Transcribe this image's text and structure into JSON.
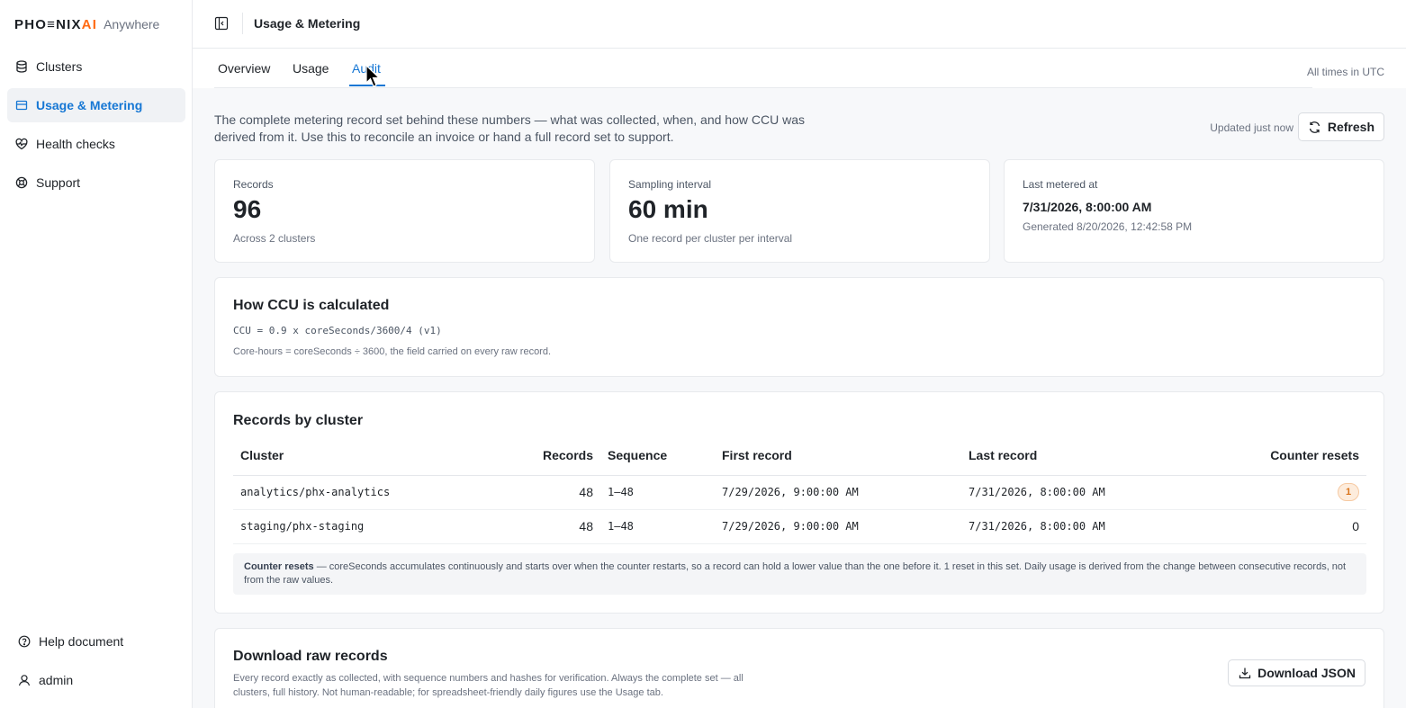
{
  "brand": {
    "logo_main_pre": "PHO",
    "logo_main_e": "≡",
    "logo_main_mid": "NIX",
    "logo_main_ai": "AI",
    "logo_sub": "Anywhere"
  },
  "sidebar": {
    "items": [
      {
        "label": "Clusters",
        "icon": "database-icon"
      },
      {
        "label": "Usage & Metering",
        "icon": "card-icon",
        "active": true
      },
      {
        "label": "Health checks",
        "icon": "heart-pulse-icon"
      },
      {
        "label": "Support",
        "icon": "lifebuoy-icon"
      }
    ],
    "bottom": [
      {
        "label": "Help document",
        "icon": "help-circle-icon"
      },
      {
        "label": "admin",
        "icon": "user-icon"
      }
    ]
  },
  "header": {
    "title": "Usage & Metering"
  },
  "tabs": [
    {
      "label": "Overview"
    },
    {
      "label": "Usage"
    },
    {
      "label": "Audit",
      "active": true
    }
  ],
  "timezone_note": "All times in UTC",
  "intro": "The complete metering record set behind these numbers — what was collected, when, and how CCU was derived from it. Use this to reconcile an invoice or hand a full record set to support.",
  "updated": "Updated just now",
  "refresh_label": "Refresh",
  "stats": {
    "records": {
      "label": "Records",
      "value": "96",
      "sub": "Across 2 clusters"
    },
    "sampling": {
      "label": "Sampling interval",
      "value": "60 min",
      "sub": "One record per cluster per interval"
    },
    "last": {
      "label": "Last metered at",
      "value": "7/31/2026, 8:00:00 AM",
      "sub": "Generated 8/20/2026, 12:42:58 PM"
    }
  },
  "ccu": {
    "title": "How CCU is calculated",
    "formula": "CCU = 0.9 x coreSeconds/3600/4 (v1)",
    "note": "Core-hours = coreSeconds ÷ 3600, the field carried on every raw record."
  },
  "by_cluster": {
    "title": "Records by cluster",
    "columns": {
      "cluster": "Cluster",
      "records": "Records",
      "sequence": "Sequence",
      "first": "First record",
      "last": "Last record",
      "resets": "Counter resets"
    },
    "rows": [
      {
        "cluster": "analytics/phx-analytics",
        "records": "48",
        "sequence": "1–48",
        "first": "7/29/2026, 9:00:00 AM",
        "last": "7/31/2026, 8:00:00 AM",
        "resets": "1"
      },
      {
        "cluster": "staging/phx-staging",
        "records": "48",
        "sequence": "1–48",
        "first": "7/29/2026, 9:00:00 AM",
        "last": "7/31/2026, 8:00:00 AM",
        "resets": "0"
      }
    ],
    "note_label": "Counter resets",
    "note_text": " — coreSeconds accumulates continuously and starts over when the counter restarts, so a record can hold a lower value than the one before it. 1 reset in this set. Daily usage is derived from the change between consecutive records, not from the raw values."
  },
  "download": {
    "title": "Download raw records",
    "desc": "Every record exactly as collected, with sequence numbers and hashes for verification. Always the complete set — all clusters, full history. Not human-readable; for spreadsheet-friendly daily figures use the Usage tab.",
    "button": "Download JSON"
  },
  "colors": {
    "accent": "#1677d4",
    "brand_ai": "#ff6a13",
    "badge_bg": "#fdecdc",
    "badge_fg": "#d9731a"
  }
}
